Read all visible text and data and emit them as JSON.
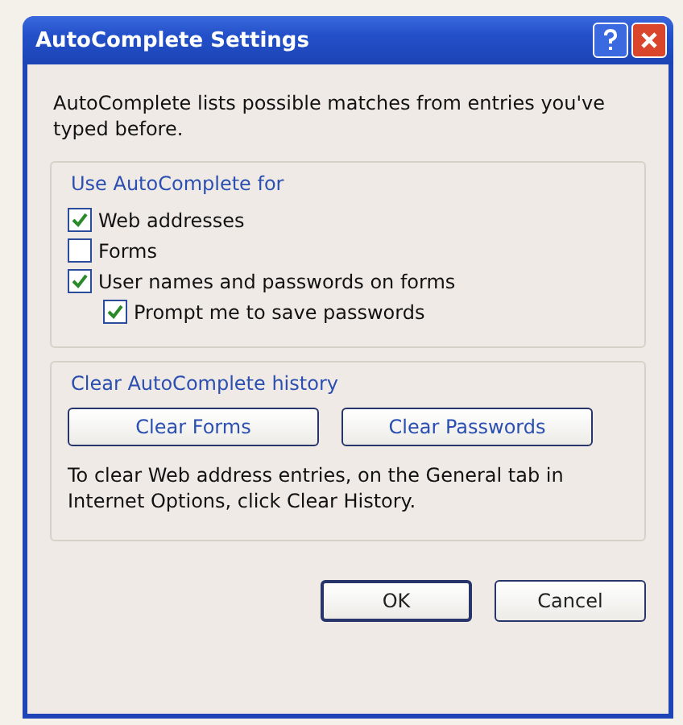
{
  "window": {
    "title": "AutoComplete Settings"
  },
  "description": "AutoComplete lists possible matches from entries you've typed before.",
  "use_group": {
    "title": "Use AutoComplete for",
    "options": [
      {
        "label": "Web addresses",
        "checked": true
      },
      {
        "label": "Forms",
        "checked": false
      },
      {
        "label": "User names and passwords on forms",
        "checked": true,
        "children": [
          {
            "label": "Prompt me to save passwords",
            "checked": true
          }
        ]
      }
    ]
  },
  "clear_group": {
    "title": "Clear AutoComplete history",
    "buttons": [
      "Clear Forms",
      "Clear Passwords"
    ],
    "note": "To clear Web address entries, on the General tab in Internet Options, click Clear History."
  },
  "buttons": [
    "OK",
    "Cancel"
  ]
}
